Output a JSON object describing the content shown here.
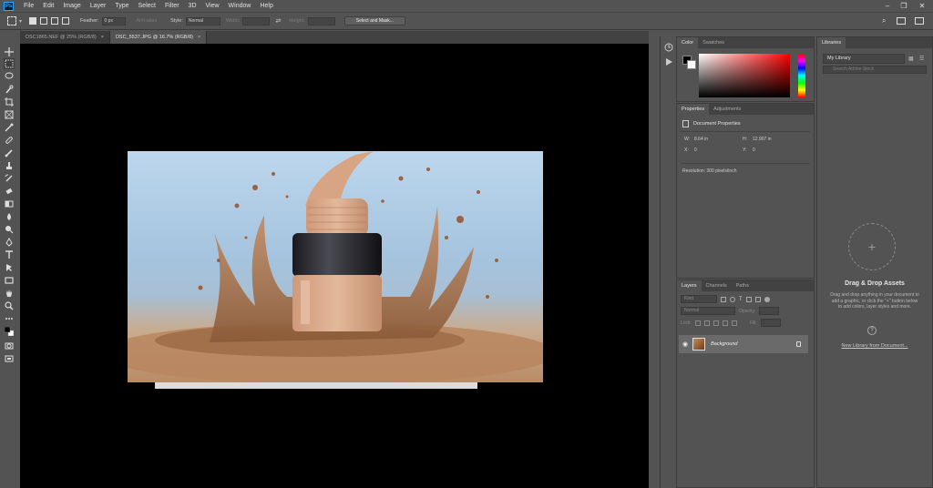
{
  "menu": [
    "File",
    "Edit",
    "Image",
    "Layer",
    "Type",
    "Select",
    "Filter",
    "3D",
    "View",
    "Window",
    "Help"
  ],
  "window_controls": {
    "minimize": "–",
    "restore": "❐",
    "close": "✕"
  },
  "options_bar": {
    "feather_label": "Feather:",
    "feather_value": "0 px",
    "anti_alias_label": "Anti-alias",
    "style_label": "Style:",
    "style_value": "Normal",
    "width_label": "Width:",
    "height_label": "Height:",
    "select_mask_label": "Select and Mask..."
  },
  "tabs": [
    {
      "label": "DSC1865.NEF @ 25% (RGB/8)",
      "close": "×"
    },
    {
      "label": "DSC_5537.JPG @ 16.7% (RGB/8)",
      "close": "×"
    }
  ],
  "color_panel": {
    "tabs": [
      "Color",
      "Swatches"
    ]
  },
  "properties_panel": {
    "tabs": [
      "Properties",
      "Adjustments"
    ],
    "title": "Document Properties",
    "w_label": "W:",
    "w_value": "8.64 in",
    "h_label": "H:",
    "h_value": "12.907 in",
    "x_label": "X:",
    "x_value": "0",
    "y_label": "Y:",
    "y_value": "0",
    "resolution": "Resolution: 300 pixels/inch"
  },
  "layers_panel": {
    "tabs": [
      "Layers",
      "Channels",
      "Paths"
    ],
    "kind_placeholder": "Kind",
    "blend_mode": "Normal",
    "opacity_label": "Opacity:",
    "lock_label": "Lock:",
    "fill_label": "Fill:",
    "layer_name": "Background"
  },
  "libraries_panel": {
    "tab": "Libraries",
    "library_name": "My Library",
    "search_placeholder": "Search Adobe Stock",
    "drop_title": "Drag & Drop Assets",
    "drop_desc": "Drag and drop anything in your document to add a graphic, or click the \"+\" button below to add colors, layer styles and more.",
    "help_glyph": "?",
    "new_library_link": "New Library from Document..."
  },
  "colors": {
    "bg": "#535353",
    "canvas": "#000000",
    "accent": "#31a8ff"
  }
}
